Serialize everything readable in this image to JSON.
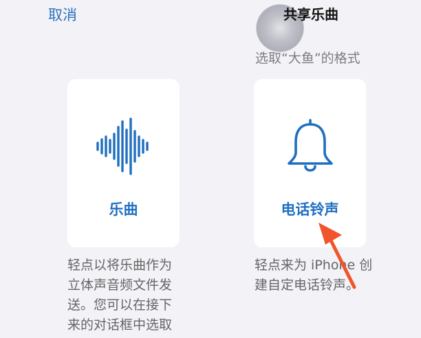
{
  "header": {
    "cancel_label": "取消",
    "title": "共享乐曲",
    "subtitle": "选取“大鱼”的格式"
  },
  "options": [
    {
      "label": "乐曲",
      "icon": "waveform-icon",
      "description_lines": [
        "轻点以将乐曲作为",
        "立体声音频文件发",
        "送。您可以在接下",
        "来的对话框中选取"
      ]
    },
    {
      "label": "电话铃声",
      "icon": "bell-icon",
      "description_lines": [
        "轻点来为 iPhone 创",
        "建自定电话铃声。"
      ]
    }
  ],
  "colors": {
    "accent": "#1f6fbf",
    "annotation_arrow": "#f0552b",
    "background": "#f2f2f7"
  }
}
